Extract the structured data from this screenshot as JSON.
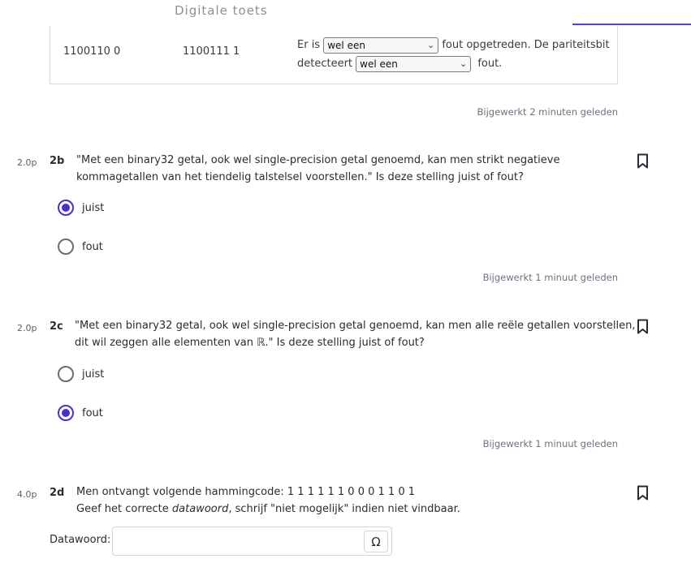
{
  "header": {
    "title": "Digitale toets"
  },
  "parity_row": {
    "col1": "1100110 0",
    "col2": "1100111 1",
    "text_before": "Er is",
    "select1": "wel een",
    "text_middle": "fout opgetreden. De pariteitsbit detecteert",
    "select2": "wel een",
    "text_after": "fout."
  },
  "updated_1": "Bijgewerkt 2 minuten geleden",
  "questions": [
    {
      "points": "2.0p",
      "number": "2b",
      "line1": "\"Met een binary32 getal, ook wel single-precision getal genoemd, kan men strikt negatieve",
      "line2": "kommagetallen van het tiendelig talstelsel voorstellen.\" Is deze stelling juist of fout?",
      "options": [
        "juist",
        "fout"
      ],
      "selected": "juist",
      "updated": "Bijgewerkt 1 minuut geleden"
    },
    {
      "points": "2.0p",
      "number": "2c",
      "line1": "\"Met een binary32 getal, ook wel single-precision getal genoemd, kan men alle reële getallen voorstellen,",
      "line2": "dit wil zeggen alle elementen van ℝ.\" Is deze stelling juist of fout?",
      "options": [
        "juist",
        "fout"
      ],
      "selected": "fout",
      "updated": "Bijgewerkt 1 minuut geleden"
    },
    {
      "points": "4.0p",
      "number": "2d",
      "line1": "Men ontvangt volgende hammingcode: 1 1 1 1 1 1 0 0 0 1 1 0 1",
      "line2_before": "Geef het correcte ",
      "line2_em": "datawoord",
      "line2_after": ", schrijf \"niet mogelijk\" indien niet vindbaar."
    }
  ],
  "datawoord": {
    "label": "Datawoord:",
    "value": "",
    "omega": "Ω"
  },
  "icons": {
    "bookmark": "bookmark-icon",
    "caret": "chevron-down-icon",
    "omega": "omega-icon"
  },
  "colors": {
    "accent": "#4a2fd0",
    "border": "#d9d9de",
    "muted": "#6f7280"
  }
}
